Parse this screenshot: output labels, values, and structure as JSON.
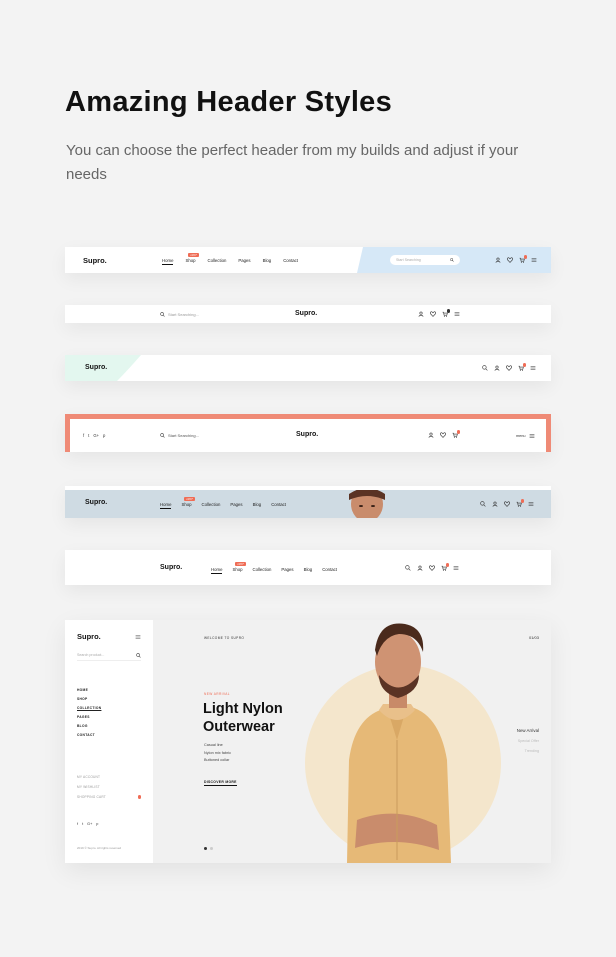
{
  "heading": "Amazing Header Styles",
  "subheading": "You can choose the perfect header from my builds and adjust if your needs",
  "brand": "Supro.",
  "nav": [
    "Home",
    "Shop",
    "Collection",
    "Pages",
    "Blog",
    "Contact"
  ],
  "hot_badge": "HOT",
  "search_placeholder": "Start Searching...",
  "search_placeholder_short": "Start Searching",
  "social": [
    "f",
    "t",
    "G+",
    "p"
  ],
  "menu_label": "menu",
  "hero": {
    "side_search": "Search product...",
    "side_menu": [
      "HOME",
      "SHOP",
      "COLLECTION",
      "PAGES",
      "BLOG",
      "CONTACT"
    ],
    "side_account": [
      "MY ACCOUNT",
      "MY WISHLIST",
      "SHOPPING CART"
    ],
    "copyright": "2019 © Supro. All rights reserved",
    "kicker": "WELCOME TO SUPRO",
    "counter": "01/03",
    "new_label": "NEW ARRIVAL",
    "headline": "Light Nylon Outerwear",
    "features": [
      "Casual line",
      "Nylon mix fabric",
      "Buttoned collar"
    ],
    "cta": "DISCOVER MORE",
    "side_labels": [
      "New Arrival",
      "Special Offer",
      "Trending"
    ]
  },
  "colors": {
    "accent": "#ef6c55",
    "blue_panel": "#d6e8f7",
    "mint_panel": "#e3f7ef",
    "border_coral": "#ef8a76",
    "gray_band": "#cfdbe3",
    "hero_circle": "#f4e6cc"
  }
}
